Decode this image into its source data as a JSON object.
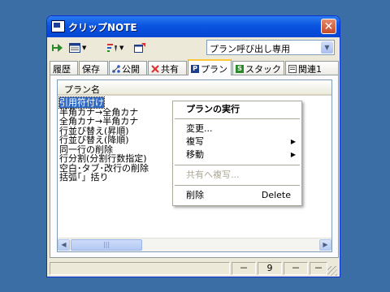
{
  "window": {
    "title": "クリップNOTE",
    "close": "✕"
  },
  "toolbar": {
    "plan_select": "プラン呼び出し専用",
    "icons": [
      "connect-icon",
      "view-icon",
      "sort-icon",
      "export-icon"
    ]
  },
  "tabs": [
    {
      "label": "履歴",
      "icon": ""
    },
    {
      "label": "保存",
      "icon": ""
    },
    {
      "label": "公開",
      "icon": "network-icon"
    },
    {
      "label": "共有",
      "icon": "share-icon"
    },
    {
      "label": "プラン",
      "icon": "plan-icon"
    },
    {
      "label": "スタック",
      "icon": "stack-icon"
    },
    {
      "label": "関連1",
      "icon": "related-icon"
    }
  ],
  "list": {
    "header": "プラン名",
    "items": [
      "引用符付け",
      "半角カナ→全角カナ",
      "全角カナ→半角カナ",
      "行並び替え(昇順)",
      "行並び替え(降順)",
      "同一行の削除",
      "行分割(分割行数指定)",
      "空白･タブ･改行の削除",
      "括弧｢」括り"
    ],
    "selected_index": 0
  },
  "context_menu": {
    "run": "プランの実行",
    "edit": "変更...",
    "copy": "複写",
    "move": "移動",
    "copy_shared": "共有へ複写...",
    "delete": "削除",
    "delete_shortcut": "Delete"
  },
  "status": {
    "cells": [
      "－",
      "9",
      "－",
      "－"
    ]
  },
  "colors": {
    "titlebar": "#0A54E0",
    "selection": "#316AC5",
    "tab_accent": "#FFC83C",
    "desktop": "#3A6EA5"
  }
}
